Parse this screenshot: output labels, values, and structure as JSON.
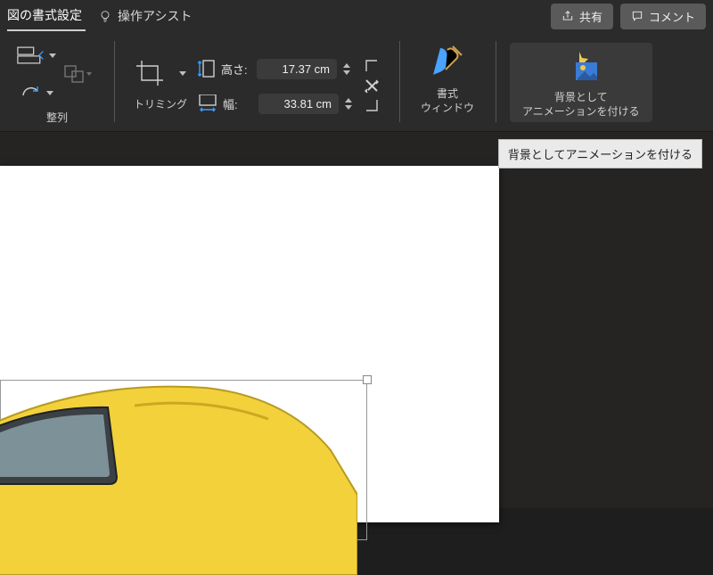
{
  "topbar": {
    "active_tab": "図の書式設定",
    "assist": "操作アシスト",
    "share": "共有",
    "comment": "コメント"
  },
  "ribbon": {
    "align_label": "整列",
    "crop_label": "トリミング",
    "height_label": "高さ:",
    "width_label": "幅:",
    "height_value": "17.37 cm",
    "width_value": "33.81 cm",
    "format_pane_l1": "書式",
    "format_pane_l2": "ウィンドウ",
    "animate_bg_l1": "背景として",
    "animate_bg_l2": "アニメーションを付ける"
  },
  "tooltip": "背景としてアニメーションを付ける"
}
